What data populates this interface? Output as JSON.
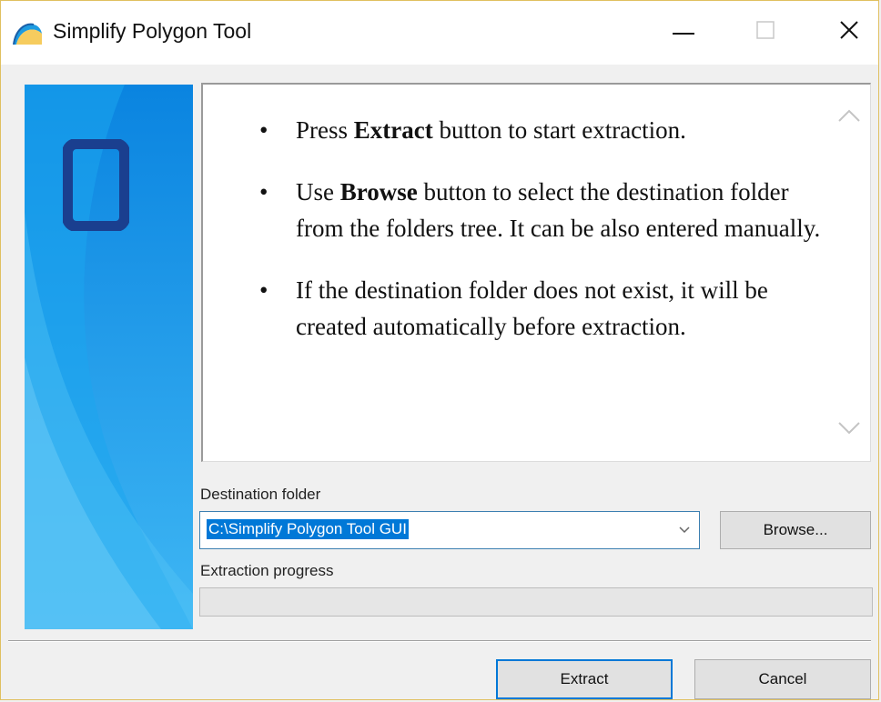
{
  "window": {
    "title": "Simplify Polygon Tool"
  },
  "colors": {
    "accent": "#0078d7",
    "side_panel_light": "#52c3f5",
    "side_panel_dark": "#0a6fd0",
    "logo_square": "#1a3f8f"
  },
  "instructions": [
    {
      "before": "Press ",
      "bold": "Extract",
      "after": " button to start extraction."
    },
    {
      "before": "Use ",
      "bold": "Browse",
      "after": " button to select the destination folder from the folders tree. It can be also entered manually."
    },
    {
      "before": "",
      "bold": "",
      "after": "If the destination folder does not exist, it will be created automatically before extraction."
    }
  ],
  "destination": {
    "label": "Destination folder",
    "value": "C:\\Simplify Polygon Tool GUI"
  },
  "browse_label": "Browse...",
  "progress": {
    "label": "Extraction progress",
    "value_percent": 0
  },
  "buttons": {
    "extract": "Extract",
    "cancel": "Cancel"
  },
  "icons": {
    "app": "app-logo-icon",
    "minimize": "minimize-icon",
    "maximize": "maximize-icon",
    "close": "close-icon",
    "scroll_up": "chevron-up-icon",
    "scroll_down": "chevron-down-icon",
    "dropdown": "chevron-down-icon"
  }
}
